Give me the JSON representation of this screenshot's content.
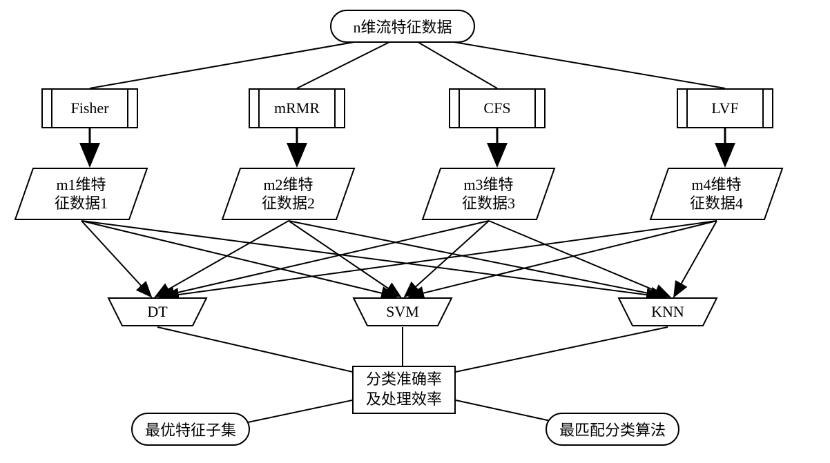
{
  "top": {
    "label": "n维流特征数据"
  },
  "methods": [
    {
      "name": "Fisher"
    },
    {
      "name": "mRMR"
    },
    {
      "name": "CFS"
    },
    {
      "name": "LVF"
    }
  ],
  "features": [
    {
      "line1": "m1维特",
      "line2": "征数据1"
    },
    {
      "line1": "m2维特",
      "line2": "征数据2"
    },
    {
      "line1": "m3维特",
      "line2": "征数据3"
    },
    {
      "line1": "m4维特",
      "line2": "征数据4"
    }
  ],
  "classifiers": [
    {
      "name": "DT"
    },
    {
      "name": "SVM"
    },
    {
      "name": "KNN"
    }
  ],
  "result": {
    "line1": "分类准确率",
    "line2": "及处理效率"
  },
  "outputs": {
    "left": "最优特征子集",
    "right": "最匹配分类算法"
  }
}
